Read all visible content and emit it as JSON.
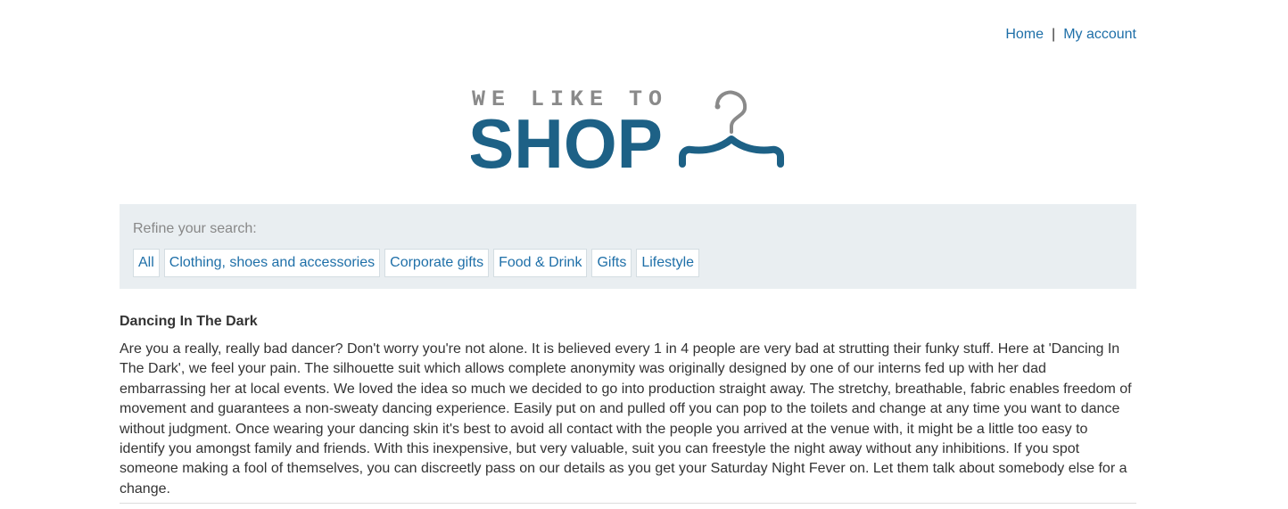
{
  "nav": {
    "home": "Home",
    "separator": "|",
    "account": "My account"
  },
  "logo": {
    "top_text": "WE LIKE TO",
    "main_text": "SHOP",
    "icon": "hanger-icon",
    "color_top": "#8a8a8a",
    "color_main": "#1d6186"
  },
  "refine": {
    "label": "Refine your search:",
    "filters": [
      "All",
      "Clothing, shoes and accessories",
      "Corporate gifts",
      "Food & Drink",
      "Gifts",
      "Lifestyle"
    ]
  },
  "product": {
    "title": "Dancing In The Dark",
    "description": "Are you a really, really bad dancer? Don't worry you're not alone. It is believed every 1 in 4 people are very bad at strutting their funky stuff. Here at 'Dancing In The Dark', we feel your pain. The silhouette suit which allows complete anonymity was originally designed by one of our interns fed up with her dad embarrassing her at local events. We loved the idea so much we decided to go into production straight away. The stretchy, breathable, fabric enables freedom of movement and guarantees a non-sweaty dancing experience. Easily put on and pulled off you can pop to the toilets and change at any time you want to dance without judgment. Once wearing your dancing skin it's best to avoid all contact with the people you arrived at the venue with, it might be a little too easy to identify you amongst family and friends. With this inexpensive, but very valuable, suit you can freestyle the night away without any inhibitions. If you spot someone making a fool of themselves, you can discreetly pass on our details as you get your Saturday Night Fever on. Let them talk about somebody else for a change."
  },
  "colors": {
    "link": "#1e6fa8",
    "panel": "#e9eef1"
  }
}
